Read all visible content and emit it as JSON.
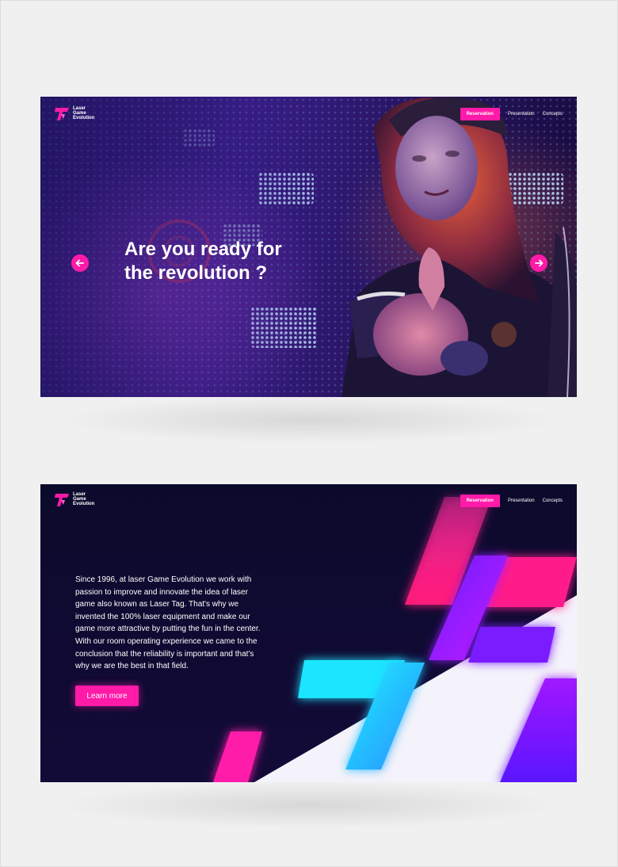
{
  "hero": {
    "logo": {
      "line1": "Laser",
      "line2": "Game",
      "line3": "Evolution"
    },
    "nav": {
      "reservation": "Reservation",
      "presentation": "Presentation",
      "concepts": "Concepts"
    },
    "headline_line1": "Are you ready for",
    "headline_line2": "the revolution ?"
  },
  "about": {
    "logo": {
      "line1": "Laser",
      "line2": "Game",
      "line3": "Evolution"
    },
    "nav": {
      "reservation": "Reservation",
      "presentation": "Presentation",
      "concepts": "Concepts"
    },
    "paragraph": [
      "Since 1996, at laser Game Evolution we work with",
      "passion to improve and innovate the idea of laser",
      "game also known as Laser Tag. That's why we",
      "invented the 100% laser equipment and make our",
      "game more attractive by putting the fun in the center.",
      "With our room operating experience we came to the",
      "conclusion that the reliability is important and that's",
      "why we are the best in that field."
    ],
    "cta": "Learn more"
  },
  "colors": {
    "accent": "#ff1aa8",
    "page_bg": "#f0f0f0",
    "dark_bg": "#0c0a2c",
    "hero_purple": "#3b1f8c",
    "cyan": "#16d9ff"
  },
  "icons": [
    "laser-game-logo-icon",
    "arrow-left-icon",
    "arrow-right-icon"
  ]
}
